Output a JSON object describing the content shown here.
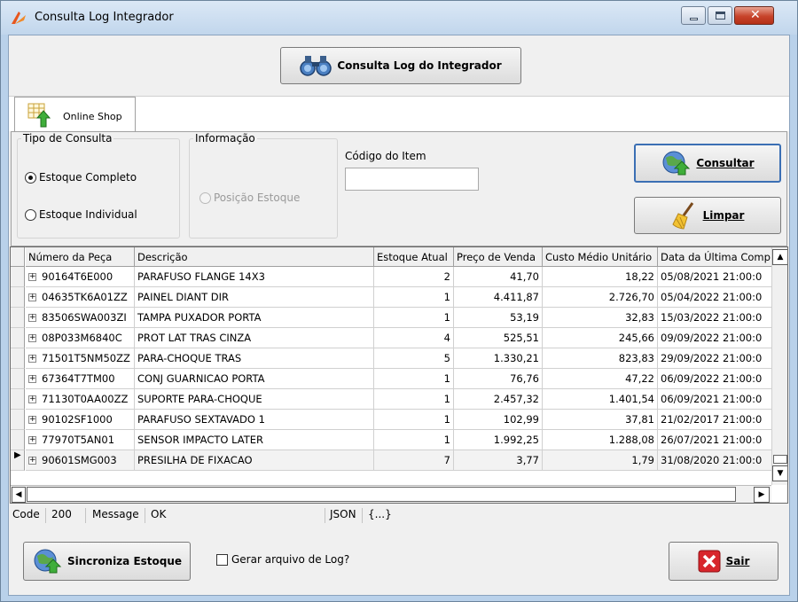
{
  "window": {
    "title": "Consulta Log Integrador"
  },
  "toolbar": {
    "consulta_log_label": "Consulta Log do Integrador"
  },
  "tabs": [
    {
      "label": "Online Shop",
      "active": true
    }
  ],
  "tipo_consulta": {
    "legend": "Tipo de Consulta",
    "options": [
      {
        "label": "Estoque Completo",
        "checked": true
      },
      {
        "label": "Estoque Individual",
        "checked": false
      }
    ]
  },
  "informacao": {
    "legend": "Informação",
    "option": "Posição Estoque"
  },
  "codigo_item": {
    "label": "Código do Item",
    "value": ""
  },
  "actions": {
    "consultar": "Consultar",
    "limpar": "Limpar"
  },
  "grid": {
    "columns": [
      "Número da Peça",
      "Descrição",
      "Estoque Atual",
      "Preço de Venda",
      "Custo Médio Unitário",
      "Data da Última Comp"
    ],
    "rows": [
      [
        "90164T6E000",
        "PARAFUSO FLANGE 14X3",
        "2",
        "41,70",
        "18,22",
        "05/08/2021 21:00:0"
      ],
      [
        "04635TK6A01ZZ",
        "PAINEL DIANT DIR",
        "1",
        "4.411,87",
        "2.726,70",
        "05/04/2022 21:00:0"
      ],
      [
        "83506SWA003ZI",
        "TAMPA PUXADOR PORTA",
        "1",
        "53,19",
        "32,83",
        "15/03/2022 21:00:0"
      ],
      [
        "08P033M6840C",
        "PROT LAT TRAS CINZA",
        "4",
        "525,51",
        "245,66",
        "09/09/2022 21:00:0"
      ],
      [
        "71501T5NM50ZZ",
        "PARA-CHOQUE TRAS",
        "5",
        "1.330,21",
        "823,83",
        "29/09/2022 21:00:0"
      ],
      [
        "67364T7TM00",
        "CONJ GUARNICAO PORTA",
        "1",
        "76,76",
        "47,22",
        "06/09/2022 21:00:0"
      ],
      [
        "71130T0AA00ZZ",
        "SUPORTE PARA-CHOQUE",
        "1",
        "2.457,32",
        "1.401,54",
        "06/09/2021 21:00:0"
      ],
      [
        "90102SF1000",
        "PARAFUSO SEXTAVADO 1",
        "1",
        "102,99",
        "37,81",
        "21/02/2017 21:00:0"
      ],
      [
        "77970T5AN01",
        "SENSOR IMPACTO LATER",
        "1",
        "1.992,25",
        "1.288,08",
        "26/07/2021 21:00:0"
      ],
      [
        "90601SMG003",
        "PRESILHA DE FIXACAO",
        "7",
        "3,77",
        "1,79",
        "31/08/2020 21:00:0"
      ]
    ],
    "selected_row": 9
  },
  "status": {
    "code_label": "Code",
    "code_value": "200",
    "message_label": "Message",
    "message_value": "OK",
    "json_label": "JSON",
    "json_value": "{...}"
  },
  "footer": {
    "sincroniza": "Sincroniza Estoque",
    "gerar_log": "Gerar arquivo de Log?",
    "sair": "Sair"
  },
  "colors": {
    "title_bg": "#c1d6ec",
    "close_red": "#c7432a",
    "panel_bg": "#f0f0f0"
  },
  "icons": [
    "app-logo-icon",
    "binoculars-icon",
    "table-arrow-icon",
    "globe-arrow-icon",
    "broom-icon",
    "close-x-icon"
  ]
}
